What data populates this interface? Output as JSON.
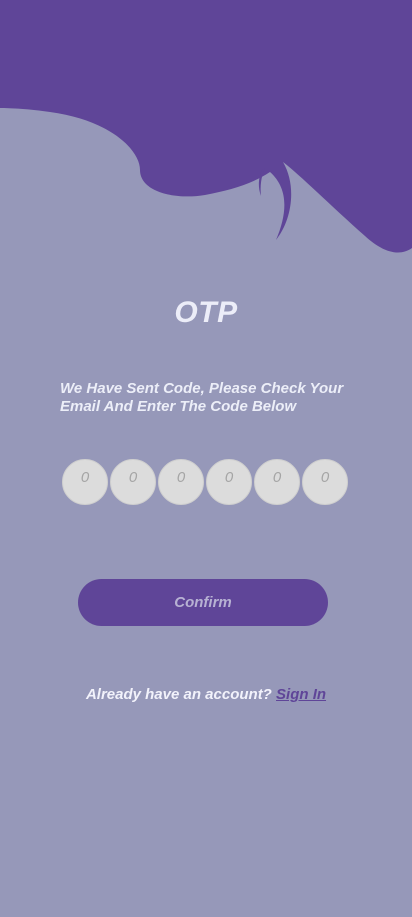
{
  "colors": {
    "brand_purple": "#5f4598",
    "background": "#9698b9",
    "otp_cell": "#dcdcdc",
    "text_light": "#ecedf8"
  },
  "screen": {
    "title": "OTP",
    "instructions": "We Have Sent Code, Please Check Your\nEmail And Enter  The Code Below"
  },
  "otp": {
    "digits": [
      "0",
      "0",
      "0",
      "0",
      "0",
      "0"
    ]
  },
  "actions": {
    "confirm_label": "Confirm"
  },
  "footer": {
    "prompt": "Already have an account?",
    "sign_in_label": "Sign In"
  }
}
